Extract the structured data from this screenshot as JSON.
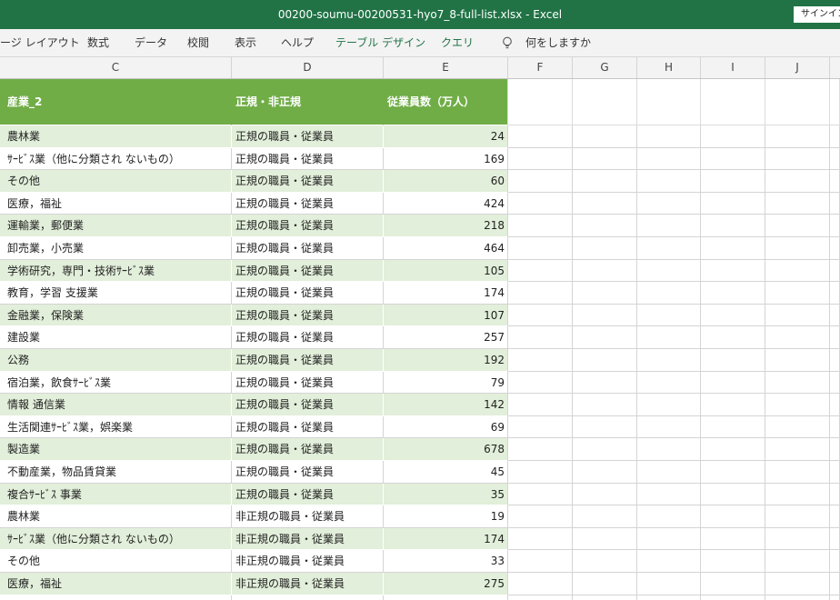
{
  "window": {
    "title": "00200-soumu-00200531-hyo7_8-full-list.xlsx  -  Excel",
    "signin_label": "サインイン"
  },
  "ribbon": {
    "tabs": [
      {
        "label": "ージ レイアウト",
        "style": "normal"
      },
      {
        "label": "数式",
        "style": "normal"
      },
      {
        "label": "データ",
        "style": "normal"
      },
      {
        "label": "校閲",
        "style": "normal"
      },
      {
        "label": "表示",
        "style": "normal"
      },
      {
        "label": "ヘルプ",
        "style": "normal"
      },
      {
        "label": "テーブル デザイン",
        "style": "green"
      },
      {
        "label": "クエリ",
        "style": "green"
      }
    ],
    "tell_me_icon": "lightbulb-icon",
    "tell_me_label": "何をしますか"
  },
  "columns": [
    "C",
    "D",
    "E",
    "F",
    "G",
    "H",
    "I",
    "J"
  ],
  "table": {
    "headers": [
      "産業_2",
      "正規・非正規",
      "従業員数（万人）"
    ],
    "rows": [
      [
        "農林業",
        "正規の職員・従業員",
        "24"
      ],
      [
        "ｻｰﾋﾞｽ業（他に分類され ないもの）",
        "正規の職員・従業員",
        "169"
      ],
      [
        "その他",
        "正規の職員・従業員",
        "60"
      ],
      [
        "医療，福祉",
        "正規の職員・従業員",
        "424"
      ],
      [
        "運輸業，郵便業",
        "正規の職員・従業員",
        "218"
      ],
      [
        "卸売業，小売業",
        "正規の職員・従業員",
        "464"
      ],
      [
        "学術研究，専門・技術ｻｰﾋﾞｽ業",
        "正規の職員・従業員",
        "105"
      ],
      [
        "教育，学習 支援業",
        "正規の職員・従業員",
        "174"
      ],
      [
        "金融業，保険業",
        "正規の職員・従業員",
        "107"
      ],
      [
        "建設業",
        "正規の職員・従業員",
        "257"
      ],
      [
        "公務",
        "正規の職員・従業員",
        "192"
      ],
      [
        "宿泊業，飲食ｻｰﾋﾞｽ業",
        "正規の職員・従業員",
        "79"
      ],
      [
        "情報 通信業",
        "正規の職員・従業員",
        "142"
      ],
      [
        "生活関連ｻｰﾋﾞｽ業，娯楽業",
        "正規の職員・従業員",
        "69"
      ],
      [
        "製造業",
        "正規の職員・従業員",
        "678"
      ],
      [
        "不動産業，物品賃貸業",
        "正規の職員・従業員",
        "45"
      ],
      [
        "複合ｻｰﾋﾞｽ 事業",
        "正規の職員・従業員",
        "35"
      ],
      [
        "農林業",
        "非正規の職員・従業員",
        "19"
      ],
      [
        "ｻｰﾋﾞｽ業（他に分類され ないもの）",
        "非正規の職員・従業員",
        "174"
      ],
      [
        "その他",
        "非正規の職員・従業員",
        "33"
      ],
      [
        "医療，福祉",
        "非正規の職員・従業員",
        "275"
      ],
      [
        "",
        "",
        ""
      ]
    ]
  },
  "colors": {
    "title_bar": "#217346",
    "header_fill": "#70ad47",
    "band_fill": "#e2efda"
  }
}
